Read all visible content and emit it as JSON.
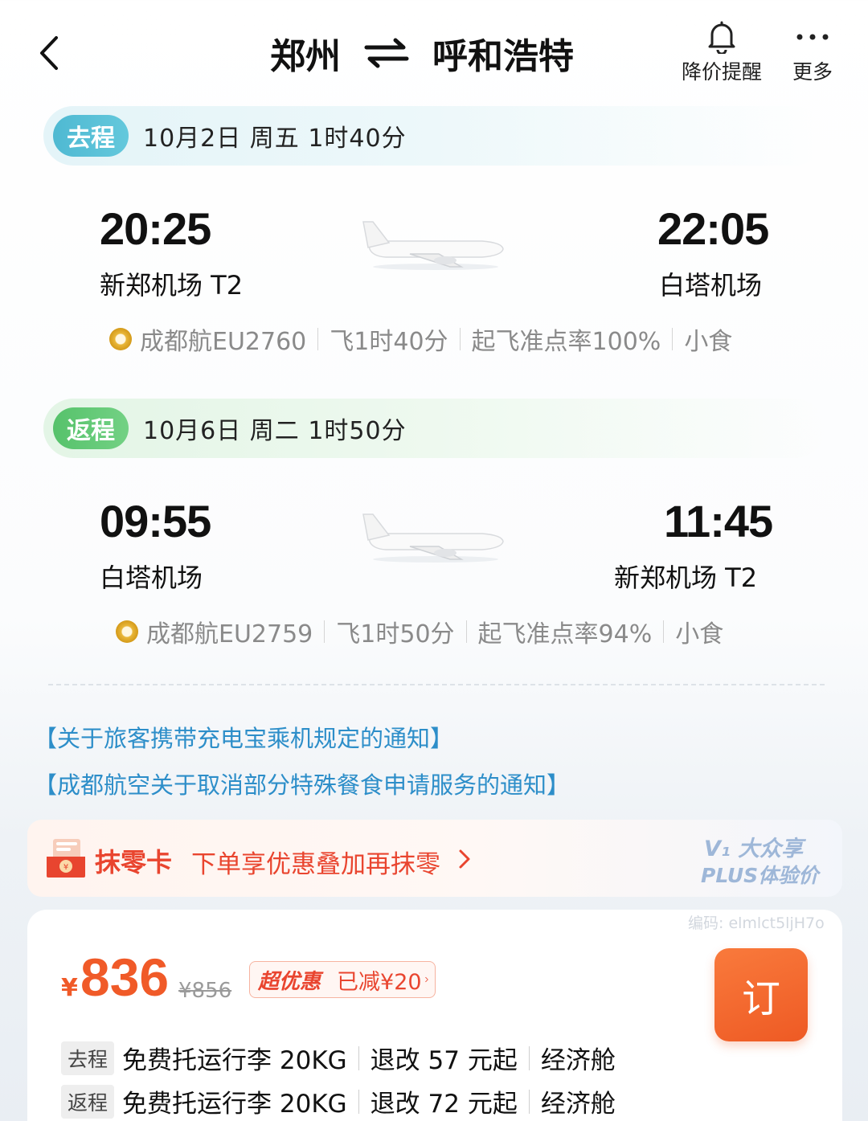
{
  "header": {
    "origin": "郑州",
    "destination": "呼和浩特",
    "alert_label": "降价提醒",
    "more_label": "更多"
  },
  "outbound": {
    "tag": "去程",
    "summary": "10月2日 周五  1时40分",
    "dep_time": "20:25",
    "dep_airport": "新郑机场 T2",
    "arr_time": "22:05",
    "arr_airport": "白塔机场",
    "airline": "成都航EU2760",
    "flight_duration": "飞1时40分",
    "on_time_rate": "起飞准点率100%",
    "meal": "小食"
  },
  "return": {
    "tag": "返程",
    "summary": "10月6日 周二  1时50分",
    "dep_time": "09:55",
    "dep_airport": "白塔机场",
    "arr_time": "11:45",
    "arr_airport": "新郑机场 T2",
    "airline": "成都航EU2759",
    "flight_duration": "飞1时50分",
    "on_time_rate": "起飞准点率94%",
    "meal": "小食"
  },
  "notices": [
    "【关于旅客携带充电宝乘机规定的通知】",
    "【成都航空关于取消部分特殊餐食申请服务的通知】"
  ],
  "promo": {
    "title": "抹零卡",
    "desc": "下单享优惠叠加再抹零",
    "plus_line1": "V₁ 大众享",
    "plus_line2": "PLUS体验价"
  },
  "watermark": "编码: elmlct5ljH7o",
  "price_card": {
    "currency": "¥",
    "price": "836",
    "original_price": "¥856",
    "badge_label": "超优惠",
    "badge_discount": "已减¥20",
    "book_label": "订",
    "rows": [
      {
        "label": "去程",
        "baggage": "免费托运行李 20KG",
        "change": "退改 57 元起",
        "cabin": "经济舱"
      },
      {
        "label": "返程",
        "baggage": "免费托运行李 20KG",
        "change": "退改 72 元起",
        "cabin": "经济舱"
      }
    ]
  },
  "colors": {
    "price": "#f05a28",
    "link": "#2d8ec9",
    "outbound_tag": "#4fb9d2",
    "return_tag": "#56c26b"
  }
}
